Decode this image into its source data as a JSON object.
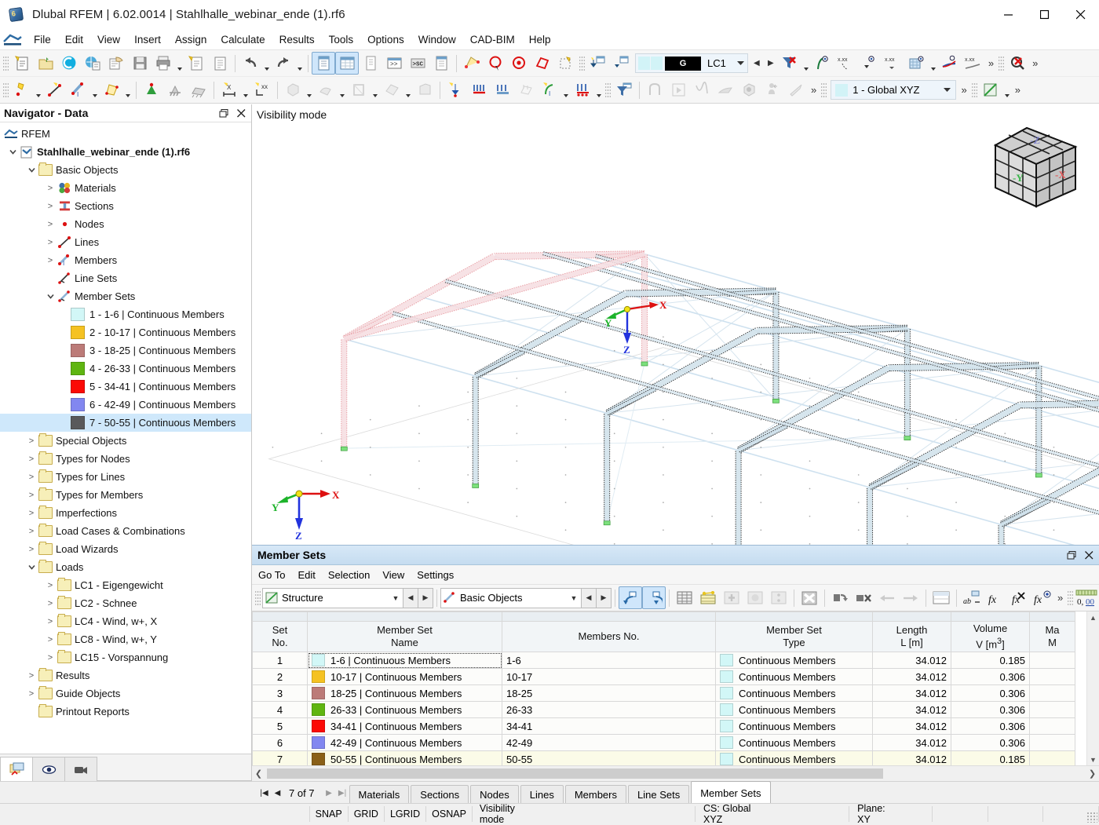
{
  "window": {
    "title": "Dlubal RFEM | 6.02.0014 | Stahlhalle_webinar_ende (1).rf6",
    "minimize": "—",
    "maximize": "▢",
    "close": "✕"
  },
  "menu": {
    "items": [
      "File",
      "Edit",
      "View",
      "Insert",
      "Assign",
      "Calculate",
      "Results",
      "Tools",
      "Options",
      "Window",
      "CAD-BIM",
      "Help"
    ]
  },
  "toolbar": {
    "load_case": {
      "label": "LC1",
      "group": "G"
    },
    "coord_system": {
      "label": "1 - Global XYZ"
    },
    "overflow": "»"
  },
  "navigator": {
    "title": "Navigator - Data",
    "restore": "❐",
    "close": "✕",
    "tree": [
      {
        "label": "RFEM",
        "depth": 0,
        "icon": "rfem-icon",
        "expander": "",
        "bold": false
      },
      {
        "label": "Stahlhalle_webinar_ende (1).rf6",
        "depth": 1,
        "icon": "file-icon",
        "expander": "v",
        "bold": true
      },
      {
        "label": "Basic Objects",
        "depth": 2,
        "icon": "folder-icon",
        "expander": "v",
        "bold": false
      },
      {
        "label": "Materials",
        "depth": 3,
        "icon": "materials-icon",
        "expander": ">",
        "bold": false
      },
      {
        "label": "Sections",
        "depth": 3,
        "icon": "sections-icon",
        "expander": ">",
        "bold": false
      },
      {
        "label": "Nodes",
        "depth": 3,
        "icon": "nodes-icon",
        "expander": ">",
        "bold": false
      },
      {
        "label": "Lines",
        "depth": 3,
        "icon": "lines-icon",
        "expander": ">",
        "bold": false
      },
      {
        "label": "Members",
        "depth": 3,
        "icon": "members-icon",
        "expander": ">",
        "bold": false
      },
      {
        "label": "Line Sets",
        "depth": 3,
        "icon": "line-sets-icon",
        "expander": "",
        "bold": false
      },
      {
        "label": "Member Sets",
        "depth": 3,
        "icon": "member-sets-icon",
        "expander": "v",
        "bold": false
      }
    ],
    "member_sets": [
      {
        "label": "1 - 1-6 | Continuous Members",
        "color": "#d2f7f7",
        "selected": false
      },
      {
        "label": "2 - 10-17 | Continuous Members",
        "color": "#f5c222",
        "selected": false
      },
      {
        "label": "3 - 18-25 | Continuous Members",
        "color": "#bc7b78",
        "selected": false
      },
      {
        "label": "4 - 26-33 | Continuous Members",
        "color": "#5fb511",
        "selected": false
      },
      {
        "label": "5 - 34-41 | Continuous Members",
        "color": "#fb0a06",
        "selected": false
      },
      {
        "label": "6 - 42-49 | Continuous Members",
        "color": "#8287f0",
        "selected": false
      },
      {
        "label": "7 - 50-55 | Continuous Members",
        "color": "#59595b",
        "selected": true
      }
    ],
    "tree_tail": [
      {
        "label": "Special Objects",
        "depth": 2,
        "expander": ">"
      },
      {
        "label": "Types for Nodes",
        "depth": 2,
        "expander": ">"
      },
      {
        "label": "Types for Lines",
        "depth": 2,
        "expander": ">"
      },
      {
        "label": "Types for Members",
        "depth": 2,
        "expander": ">"
      },
      {
        "label": "Imperfections",
        "depth": 2,
        "expander": ">"
      },
      {
        "label": "Load Cases & Combinations",
        "depth": 2,
        "expander": ">"
      },
      {
        "label": "Load Wizards",
        "depth": 2,
        "expander": ">"
      },
      {
        "label": "Loads",
        "depth": 2,
        "expander": "v"
      },
      {
        "label": "LC1 - Eigengewicht",
        "depth": 3,
        "expander": ">"
      },
      {
        "label": "LC2 - Schnee",
        "depth": 3,
        "expander": ">"
      },
      {
        "label": "LC4 - Wind, w+, X",
        "depth": 3,
        "expander": ">"
      },
      {
        "label": "LC8 - Wind, w+, Y",
        "depth": 3,
        "expander": ">"
      },
      {
        "label": "LC15 - Vorspannung",
        "depth": 3,
        "expander": ">"
      },
      {
        "label": "Results",
        "depth": 2,
        "expander": ">"
      },
      {
        "label": "Guide Objects",
        "depth": 2,
        "expander": ">"
      },
      {
        "label": "Printout Reports",
        "depth": 2,
        "expander": ""
      }
    ],
    "footer_tabs": [
      "data-navigator-icon",
      "visibility-eye-icon",
      "camera-icon"
    ]
  },
  "viewport": {
    "mode_label": "Visibility mode",
    "axes": {
      "x": "X",
      "y": "Y",
      "z": "Z"
    },
    "viewcube": {
      "face_left": "-Y",
      "face_right": "-X",
      "face_top": "-Z"
    }
  },
  "table_panel": {
    "title": "Member Sets",
    "restore": "❐",
    "close": "✕",
    "menu": [
      "Go To",
      "Edit",
      "Selection",
      "View",
      "Settings"
    ],
    "combo_structure": "Structure",
    "combo_objects": "Basic Objects",
    "numeric_button": "0,00",
    "overflow": "»",
    "columns": [
      {
        "l1": "Set",
        "l2": "No."
      },
      {
        "l1": "Member Set",
        "l2": "Name"
      },
      {
        "l1": "",
        "l2": "Members No."
      },
      {
        "l1": "Member Set",
        "l2": "Type"
      },
      {
        "l1": "Length",
        "l2": "L [m]"
      },
      {
        "l1": "Volume",
        "l2": "V [m3]"
      },
      {
        "l1": "Ma",
        "l2": "M"
      }
    ],
    "rows": [
      {
        "no": "1",
        "color": "#d2f7f7",
        "name": "1-6 | Continuous Members",
        "members": "1-6",
        "type": "Continuous Members",
        "length": "34.012",
        "volume": "0.185",
        "mass": ""
      },
      {
        "no": "2",
        "color": "#f5c222",
        "name": "10-17 | Continuous Members",
        "members": "10-17",
        "type": "Continuous Members",
        "length": "34.012",
        "volume": "0.306",
        "mass": ""
      },
      {
        "no": "3",
        "color": "#bc7b78",
        "name": "18-25 | Continuous Members",
        "members": "18-25",
        "type": "Continuous Members",
        "length": "34.012",
        "volume": "0.306",
        "mass": ""
      },
      {
        "no": "4",
        "color": "#5fb511",
        "name": "26-33 | Continuous Members",
        "members": "26-33",
        "type": "Continuous Members",
        "length": "34.012",
        "volume": "0.306",
        "mass": ""
      },
      {
        "no": "5",
        "color": "#fb0a06",
        "name": "34-41 | Continuous Members",
        "members": "34-41",
        "type": "Continuous Members",
        "length": "34.012",
        "volume": "0.306",
        "mass": ""
      },
      {
        "no": "6",
        "color": "#8287f0",
        "name": "42-49 | Continuous Members",
        "members": "42-49",
        "type": "Continuous Members",
        "length": "34.012",
        "volume": "0.306",
        "mass": ""
      },
      {
        "no": "7",
        "color": "#8a6018",
        "name": "50-55 | Continuous Members",
        "members": "50-55",
        "type": "Continuous Members",
        "length": "34.012",
        "volume": "0.185",
        "mass": ""
      }
    ],
    "type_swatch_color": "#d2f7f7"
  },
  "bottom": {
    "page_indicator": "7 of 7",
    "first": "|◀",
    "prev": "◀",
    "next": "▶",
    "last": "▶|",
    "tabs": [
      "Materials",
      "Sections",
      "Nodes",
      "Lines",
      "Members",
      "Line Sets",
      "Member Sets"
    ],
    "active_tab": "Member Sets"
  },
  "statusbar": {
    "toggles": [
      "SNAP",
      "GRID",
      "LGRID",
      "OSNAP"
    ],
    "mode": "Visibility mode",
    "cs": "CS: Global XYZ",
    "plane": "Plane: XY"
  }
}
